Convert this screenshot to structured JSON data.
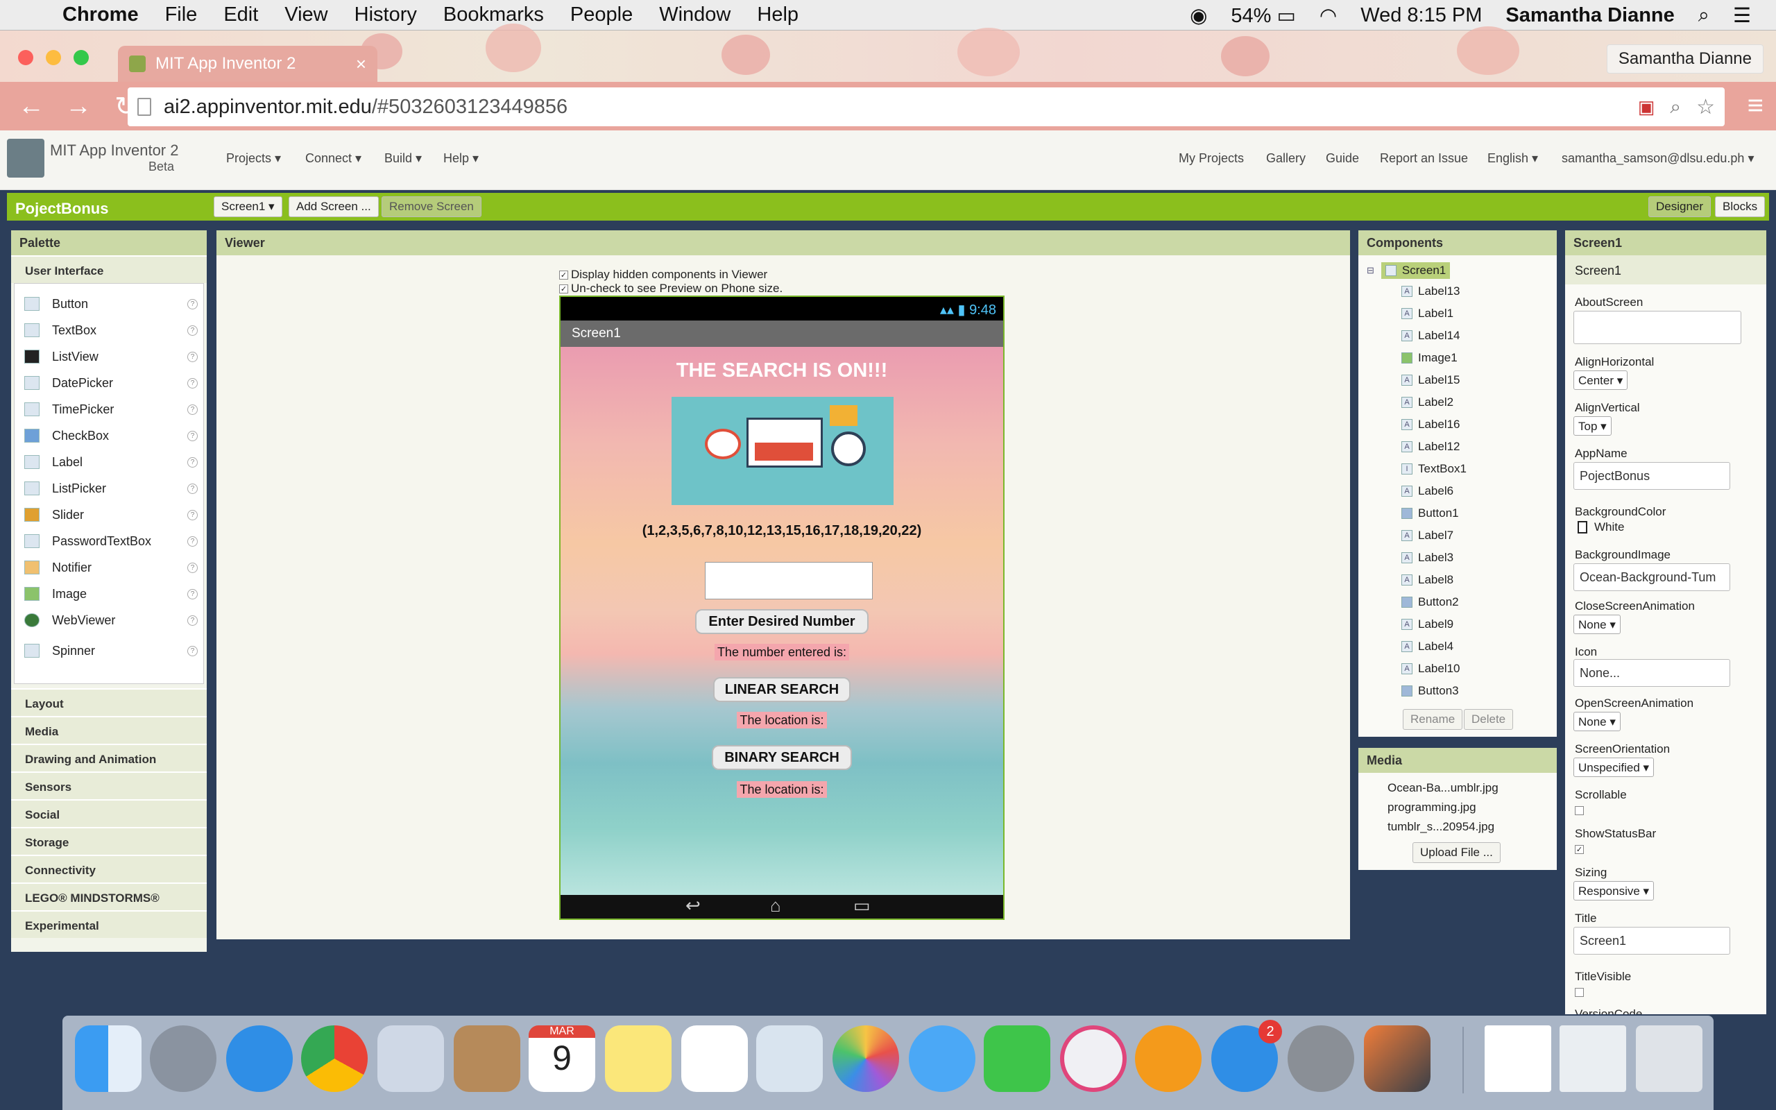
{
  "menubar": {
    "items": [
      "Chrome",
      "File",
      "Edit",
      "View",
      "History",
      "Bookmarks",
      "People",
      "Window",
      "Help"
    ],
    "battery": "54%",
    "datetime": "Wed 8:15 PM",
    "user": "Samantha Dianne"
  },
  "browser": {
    "tab_title": "MIT App Inventor 2",
    "profile": "Samantha Dianne",
    "url_host": "ai2.appinventor.mit.edu",
    "url_path": "/#5032603123449856"
  },
  "app": {
    "title": "MIT App Inventor 2",
    "beta": "Beta",
    "menus": [
      "Projects",
      "Connect",
      "Build",
      "Help"
    ],
    "right_links": [
      "My Projects",
      "Gallery",
      "Guide",
      "Report an Issue"
    ],
    "language": "English",
    "account": "samantha_samson@dlsu.edu.ph"
  },
  "project": {
    "name": "PojectBonus",
    "screen_select": "Screen1",
    "add_screen": "Add Screen ...",
    "remove_screen": "Remove Screen",
    "designer": "Designer",
    "blocks": "Blocks"
  },
  "palette": {
    "title": "Palette",
    "open_category": "User Interface",
    "items": [
      "Button",
      "TextBox",
      "ListView",
      "DatePicker",
      "TimePicker",
      "CheckBox",
      "Label",
      "ListPicker",
      "Slider",
      "PasswordTextBox",
      "Notifier",
      "Image",
      "WebViewer",
      "Spinner"
    ],
    "categories": [
      "Layout",
      "Media",
      "Drawing and Animation",
      "Sensors",
      "Social",
      "Storage",
      "Connectivity",
      "LEGO® MINDSTORMS®",
      "Experimental"
    ]
  },
  "viewer": {
    "title": "Viewer",
    "opt1": "Display hidden components in Viewer",
    "opt2": "Un-check to see Preview on Phone size."
  },
  "phone": {
    "time": "9:48",
    "screen_title": "Screen1",
    "heading": "THE SEARCH IS ON!!!",
    "numbers": "(1,2,3,5,6,7,8,10,12,13,15,16,17,18,19,20,22)",
    "btn_enter": "Enter Desired Number",
    "lbl_entered": "The number entered is:",
    "btn_linear": "LINEAR SEARCH",
    "lbl_loc1": "The location is:",
    "btn_binary": "BINARY SEARCH",
    "lbl_loc2": "The location is:"
  },
  "components": {
    "title": "Components",
    "root": "Screen1",
    "items": [
      "Label13",
      "Label1",
      "Label14",
      "Image1",
      "Label15",
      "Label2",
      "Label16",
      "Label12",
      "TextBox1",
      "Label6",
      "Button1",
      "Label7",
      "Label3",
      "Label8",
      "Button2",
      "Label9",
      "Label4",
      "Label10",
      "Button3"
    ],
    "rename": "Rename",
    "delete": "Delete"
  },
  "media": {
    "title": "Media",
    "files": [
      "Ocean-Ba...umblr.jpg",
      "programming.jpg",
      "tumblr_s...20954.jpg"
    ],
    "upload": "Upload File ..."
  },
  "properties": {
    "title": "Screen1",
    "screen": "Screen1",
    "about_label": "AboutScreen",
    "alignh_label": "AlignHorizontal",
    "alignh": "Center",
    "alignv_label": "AlignVertical",
    "alignv": "Top",
    "appname_label": "AppName",
    "appname": "PojectBonus",
    "bgcolor_label": "BackgroundColor",
    "bgcolor": "White",
    "bgimage_label": "BackgroundImage",
    "bgimage": "Ocean-Background-Tum",
    "closeanim_label": "CloseScreenAnimation",
    "closeanim": "None",
    "icon_label": "Icon",
    "icon": "None...",
    "openanim_label": "OpenScreenAnimation",
    "openanim": "None",
    "orient_label": "ScreenOrientation",
    "orient": "Unspecified",
    "scroll_label": "Scrollable",
    "statusbar_label": "ShowStatusBar",
    "sizing_label": "Sizing",
    "sizing": "Responsive",
    "title_label": "Title",
    "titlevis_label": "TitleVisible",
    "version_label": "VersionCode"
  },
  "dock": {
    "calendar_month": "MAR",
    "calendar_day": "9",
    "appstore_badge": "2"
  },
  "colors": {
    "green_bar": "#8bbf1d",
    "chrome_toolbar": "#e9a59c"
  }
}
